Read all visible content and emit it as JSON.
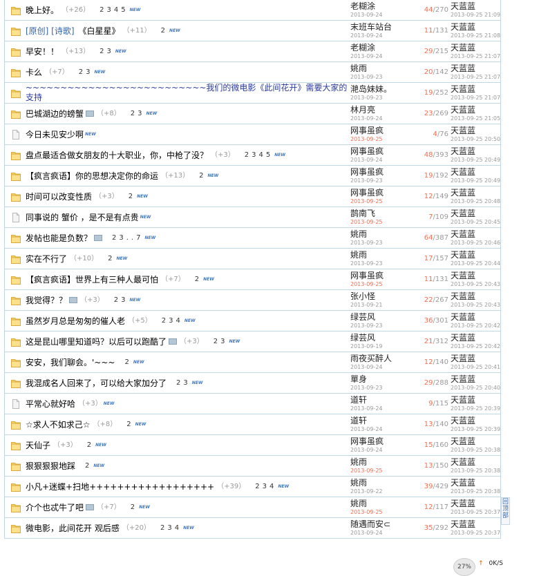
{
  "rows": [
    {
      "icon": "folder",
      "title": "晚上好。",
      "replies_label": "（+26）",
      "pages": [
        "2",
        "3",
        "4",
        "5"
      ],
      "new": true,
      "author": "老糊涂",
      "author_date": "2013-09-24",
      "hot": false,
      "rep": "44",
      "views": "270",
      "last": "天蓝蓝",
      "last_date": "2013-09-25 21:09"
    },
    {
      "icon": "folder",
      "prefix": "[原创] [诗歌]",
      "title": "《白星星》",
      "replies_label": "（+11）",
      "pages": [
        "2"
      ],
      "new": true,
      "author": "末班车站台",
      "author_date": "2013-09-24",
      "hot": false,
      "rep": "11",
      "views": "131",
      "last": "天蓝蓝",
      "last_date": "2013-09-25 21:08"
    },
    {
      "icon": "folder",
      "title": "早安！！",
      "replies_label": "（+13）",
      "pages": [
        "2",
        "3"
      ],
      "new": true,
      "author": "老糊涂",
      "author_date": "2013-09-24",
      "hot": false,
      "rep": "29",
      "views": "215",
      "last": "天蓝蓝",
      "last_date": "2013-09-25 21:07"
    },
    {
      "icon": "folder",
      "title": "卡么",
      "replies_label": "（+7）",
      "pages": [
        "2",
        "3"
      ],
      "new": true,
      "author": "姚雨",
      "author_date": "2013-09-23",
      "hot": false,
      "rep": "20",
      "views": "142",
      "last": "天蓝蓝",
      "last_date": "2013-09-25 21:07"
    },
    {
      "icon": "folder",
      "title": "~~~~~~~~~~~~~~~~~~~~~~~~~~我们的微电影《此间花开》需要大家的支持",
      "blue": true,
      "replies_label": "（+3）",
      "pages": [
        "2"
      ],
      "new": true,
      "author": "滟岛妹妹。",
      "author_date": "2013-09-23",
      "hot": false,
      "rep": "19",
      "views": "252",
      "last": "天蓝蓝",
      "last_date": "2013-09-25 21:07"
    },
    {
      "icon": "folder",
      "title": "巴城湖边的螃蟹",
      "img": true,
      "replies_label": "（+8）",
      "pages": [
        "2",
        "3"
      ],
      "new": true,
      "author": "林月亮",
      "author_date": "2013-09-24",
      "hot": false,
      "rep": "23",
      "views": "269",
      "last": "天蓝蓝",
      "last_date": "2013-09-25 21:05"
    },
    {
      "icon": "doc",
      "title": "今日未见安少啊",
      "replies_label": "",
      "pages": [],
      "new": true,
      "author": "网事虽疯",
      "author_date": "2013-09-25",
      "hot": true,
      "rep": "4",
      "views": "76",
      "last": "天蓝蓝",
      "last_date": "2013-09-25 20:50"
    },
    {
      "icon": "folder",
      "title": "盘点最适合做女朋友的十大职业，你，中枪了没？",
      "replies_label": "（+3）",
      "pages": [
        "2",
        "3",
        "4",
        "5"
      ],
      "new": true,
      "author": "网事虽疯",
      "author_date": "2013-09-24",
      "hot": false,
      "rep": "48",
      "views": "393",
      "last": "天蓝蓝",
      "last_date": "2013-09-25 20:49"
    },
    {
      "icon": "folder",
      "title": "【疯言疯语】你的思想决定你的命运",
      "replies_label": "（+13）",
      "pages": [
        "2"
      ],
      "new": true,
      "author": "网事虽疯",
      "author_date": "2013-09-23",
      "hot": false,
      "rep": "19",
      "views": "192",
      "last": "天蓝蓝",
      "last_date": "2013-09-25 20:49"
    },
    {
      "icon": "folder",
      "title": "时间可以改变性质",
      "replies_label": "（+3）",
      "pages": [
        "2"
      ],
      "new": true,
      "author": "网事虽疯",
      "author_date": "2013-09-25",
      "hot": true,
      "rep": "12",
      "views": "149",
      "last": "天蓝蓝",
      "last_date": "2013-09-25 20:48"
    },
    {
      "icon": "doc",
      "title": "同事说的 蟹价 ，是不是有点贵",
      "replies_label": "",
      "pages": [],
      "new": true,
      "author": "鹊南飞",
      "author_date": "2013-09-25",
      "hot": true,
      "rep": "7",
      "views": "109",
      "last": "天蓝蓝",
      "last_date": "2013-09-25 20:45"
    },
    {
      "icon": "folder",
      "title": "发帖也能是负数？",
      "img": true,
      "replies_label": "",
      "pages": [
        "2",
        "3",
        "..",
        "7"
      ],
      "new": true,
      "author": "姚雨",
      "author_date": "2013-09-23",
      "hot": false,
      "rep": "64",
      "views": "387",
      "last": "天蓝蓝",
      "last_date": "2013-09-25 20:46"
    },
    {
      "icon": "folder",
      "title": "实在不行了",
      "replies_label": "（+10）",
      "pages": [
        "2"
      ],
      "new": true,
      "author": "姚雨",
      "author_date": "2013-09-23",
      "hot": false,
      "rep": "17",
      "views": "157",
      "last": "天蓝蓝",
      "last_date": "2013-09-25 20:44"
    },
    {
      "icon": "folder",
      "title": "【疯言疯语】世界上有三种人最可怕",
      "replies_label": "（+7）",
      "pages": [
        "2"
      ],
      "new": true,
      "author": "网事虽疯",
      "author_date": "2013-09-25",
      "hot": true,
      "rep": "11",
      "views": "131",
      "last": "天蓝蓝",
      "last_date": "2013-09-25 20:43"
    },
    {
      "icon": "folder",
      "title": "我觉得？？",
      "img": true,
      "replies_label": "（+3）",
      "pages": [
        "2",
        "3"
      ],
      "new": true,
      "author": "张小怪",
      "author_date": "2013-09-21",
      "hot": false,
      "rep": "22",
      "views": "267",
      "last": "天蓝蓝",
      "last_date": "2013-09-25 20:43"
    },
    {
      "icon": "folder",
      "title": "虽然岁月总是匆匆的催人老",
      "replies_label": "（+5）",
      "pages": [
        "2",
        "3",
        "4"
      ],
      "new": true,
      "author": "绿芸风",
      "author_date": "2013-09-23",
      "hot": false,
      "rep": "36",
      "views": "301",
      "last": "天蓝蓝",
      "last_date": "2013-09-25 20:42"
    },
    {
      "icon": "folder",
      "title": "这是昆山哪里知道吗？以后可以跑酷了",
      "img": true,
      "replies_label": "（+3）",
      "pages": [
        "2",
        "3"
      ],
      "new": true,
      "author": "绿芸风",
      "author_date": "2013-09-19",
      "hot": false,
      "rep": "21",
      "views": "312",
      "last": "天蓝蓝",
      "last_date": "2013-09-25 20:42"
    },
    {
      "icon": "folder",
      "title": "安安，我们聊会。'~~~",
      "replies_label": "",
      "pages": [
        "2"
      ],
      "new": true,
      "author": "雨夜买醉人",
      "author_date": "2013-09-24",
      "hot": false,
      "rep": "12",
      "views": "140",
      "last": "天蓝蓝",
      "last_date": "2013-09-25 20:41"
    },
    {
      "icon": "folder",
      "title": "我混成名人回来了，可以给大家加分了",
      "replies_label": "",
      "pages": [
        "2",
        "3"
      ],
      "new": true,
      "author": "單身",
      "author_date": "2013-09-23",
      "hot": false,
      "rep": "29",
      "views": "288",
      "last": "天蓝蓝",
      "last_date": "2013-09-25 20:40"
    },
    {
      "icon": "doc",
      "title": "平常心就好哈",
      "replies_label": "（+3）",
      "pages": [],
      "new": true,
      "author": "道轩",
      "author_date": "2013-09-24",
      "hot": false,
      "rep": "9",
      "views": "115",
      "last": "天蓝蓝",
      "last_date": "2013-09-25 20:39"
    },
    {
      "icon": "folder",
      "title": "☆求人不如求己☆",
      "replies_label": "（+8）",
      "pages": [
        "2"
      ],
      "new": true,
      "author": "道轩",
      "author_date": "2013-09-24",
      "hot": false,
      "rep": "13",
      "views": "140",
      "last": "天蓝蓝",
      "last_date": "2013-09-25 20:39"
    },
    {
      "icon": "folder",
      "title": "天仙子",
      "replies_label": "（+3）",
      "pages": [
        "2"
      ],
      "new": true,
      "author": "网事虽疯",
      "author_date": "2013-09-24",
      "hot": false,
      "rep": "15",
      "views": "160",
      "last": "天蓝蓝",
      "last_date": "2013-09-25 20:38"
    },
    {
      "icon": "folder",
      "title": "狠狠狠狠地踩",
      "replies_label": "",
      "pages": [
        "2"
      ],
      "new": true,
      "author": "姚雨",
      "author_date": "2013-09-25",
      "hot": true,
      "rep": "13",
      "views": "150",
      "last": "天蓝蓝",
      "last_date": "2013-09-25 20:38"
    },
    {
      "icon": "folder",
      "title": "小凡+迷蝶+扫地++++++++++++++++++",
      "replies_label": "（+39）",
      "pages": [
        "2",
        "3",
        "4"
      ],
      "new": true,
      "author": "姚雨",
      "author_date": "2013-09-22",
      "hot": false,
      "rep": "39",
      "views": "429",
      "last": "天蓝蓝",
      "last_date": "2013-09-25 20:38"
    },
    {
      "icon": "folder",
      "title": "介个也忒牛了吧",
      "img": true,
      "replies_label": "（+7）",
      "pages": [
        "2"
      ],
      "new": true,
      "author": "姚雨",
      "author_date": "2013-09-25",
      "hot": true,
      "rep": "12",
      "views": "117",
      "last": "天蓝蓝",
      "last_date": "2013-09-25 20:37"
    },
    {
      "icon": "folder",
      "title": "微电影，此间花开 观后感",
      "replies_label": "（+20）",
      "pages": [
        "2",
        "3",
        "4"
      ],
      "new": true,
      "author": "随遇而安⊂",
      "author_date": "2013-09-24",
      "hot": false,
      "rep": "35",
      "views": "292",
      "last": "天蓝蓝",
      "last_date": "2013-09-25 20:37"
    }
  ],
  "new_label": "NEW",
  "back_top_label": "回顶部",
  "zoom": "27%",
  "speed": "0K/S",
  "colors": {
    "border": "#c2d5e3",
    "hot": "#f26c4f",
    "blue_link": "#2b3a9c",
    "category": "#3464a8"
  }
}
